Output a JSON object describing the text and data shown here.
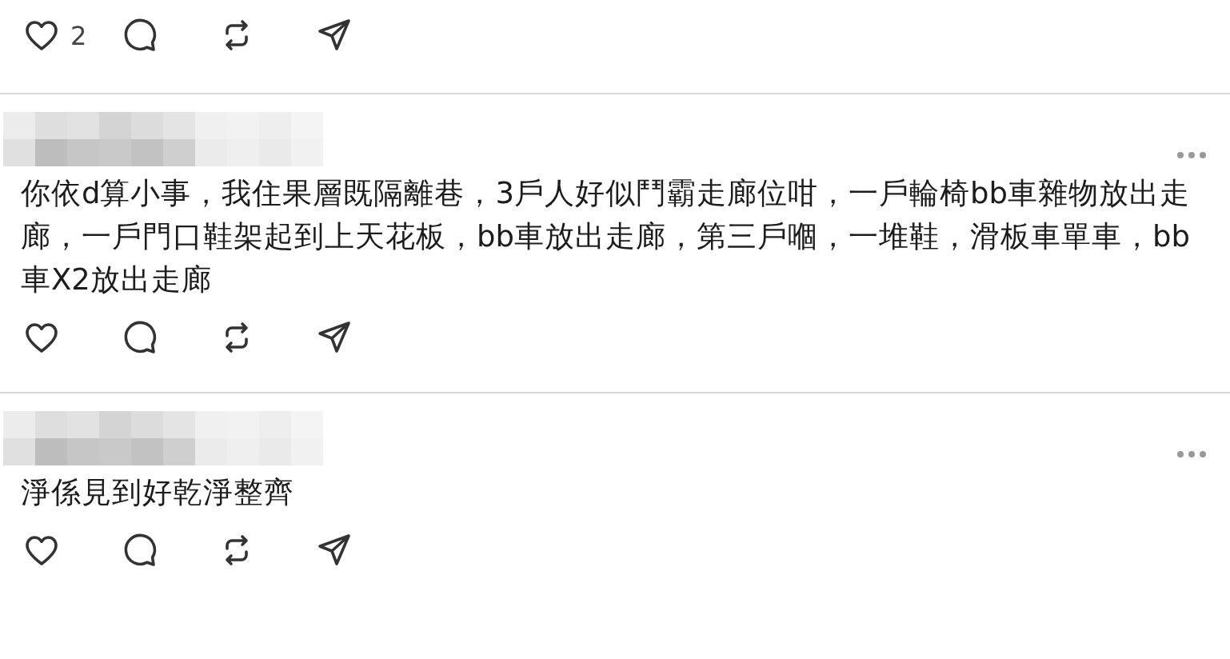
{
  "posts": [
    {
      "author_hidden": false,
      "likes": "2"
    },
    {
      "author_hidden": true,
      "more": true,
      "text": "你依d算小事，我住果層既隔離巷，3戶人好似鬥霸走廊位咁，一戶輪椅bb車雜物放出走廊，一戶門口鞋架起到上天花板，bb車放出走廊，第三戶嗰，一堆鞋，滑板車單車，bb車X2放出走廊"
    },
    {
      "author_hidden": true,
      "more": true,
      "text": "淨係見到好乾淨整齊"
    }
  ]
}
